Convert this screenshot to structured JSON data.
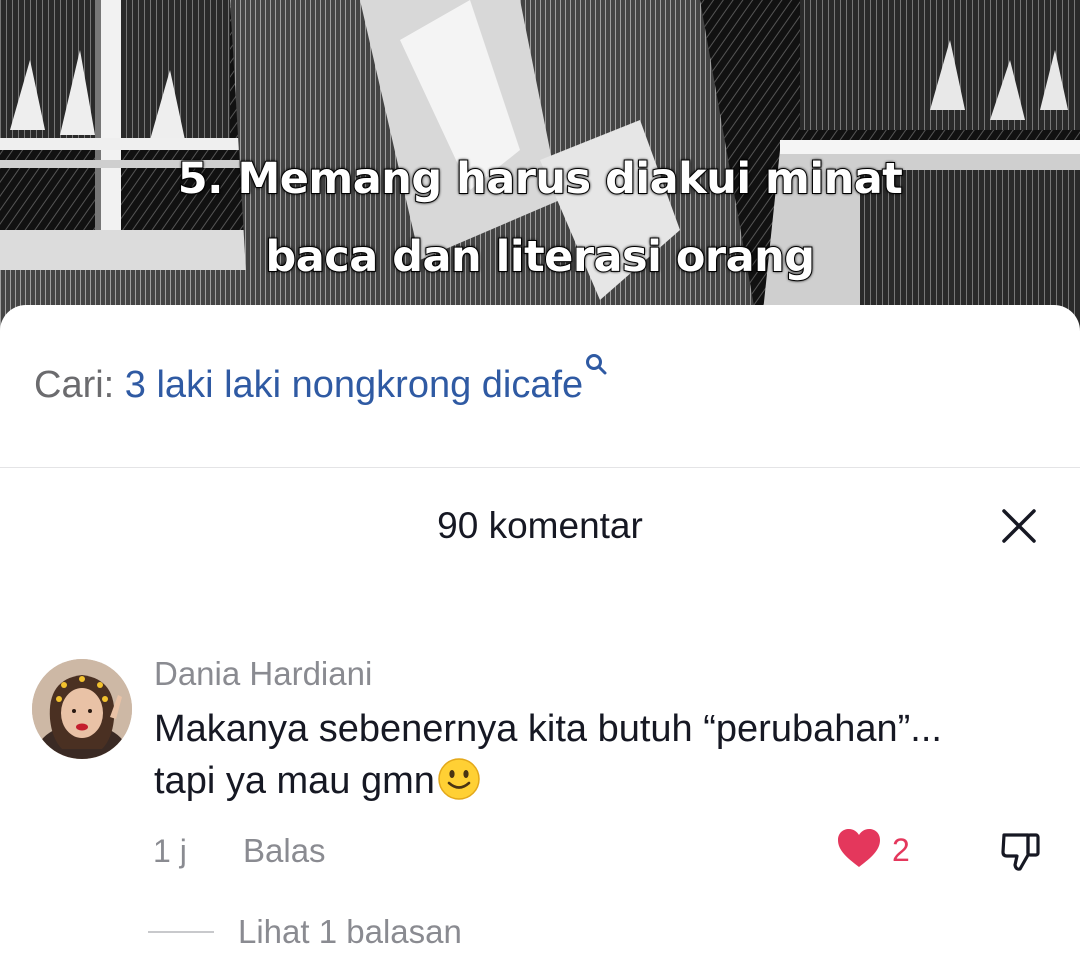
{
  "video": {
    "caption_lines": [
      "5. Memang harus diakui minat",
      "baca dan literasi orang"
    ]
  },
  "search": {
    "prefix": "Cari:",
    "query": "3 laki laki nongkrong dicafe",
    "icon": "search-icon"
  },
  "comments_panel": {
    "title": "90 komentar",
    "close_icon": "close-icon"
  },
  "comment": {
    "author": "Dania Hardiani",
    "text_lines": [
      "Makanya sebenernya kita butuh “perubahan”...",
      "tapi ya mau gmn"
    ],
    "emoji": "slightly-smiling-face",
    "time": "1 j",
    "reply_label": "Balas",
    "like_count": "2",
    "liked": true,
    "like_color": "#e4375c",
    "view_replies_label": "Lihat 1 balasan"
  },
  "colors": {
    "search_query": "#2f5aa3",
    "muted_text": "#8a8b91",
    "primary_text": "#161823"
  }
}
